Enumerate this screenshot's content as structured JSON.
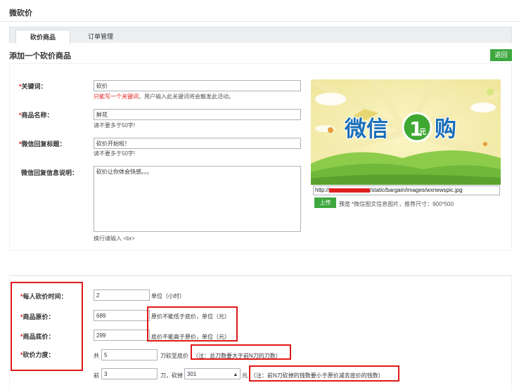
{
  "page_title": "微砍价",
  "tabs": [
    {
      "label": "砍价商品",
      "active": true
    },
    {
      "label": "订单管理",
      "active": false
    }
  ],
  "section_title": "添加一个砍价商品",
  "back_label": "返回",
  "fields": {
    "keyword": {
      "label": "关键词：",
      "value": "砍价",
      "hint_prefix": "只能写一个关键词",
      "hint_suffix": "，用户输入此关键词将会触发此活动。"
    },
    "product_name": {
      "label": "商品名称：",
      "value": "鲜花",
      "hint": "请不要多于50字!"
    },
    "reply_title": {
      "label": "微信回复标题：",
      "value": "砍价开始啦！",
      "hint": "请不要多于50字!"
    },
    "reply_desc": {
      "label": "微信回复信息说明：",
      "value": "砍价让你体会快感。。。",
      "hint": "换行请输入 <br>"
    }
  },
  "image": {
    "url_prefix": "http://",
    "url_suffix": "/static/bargain/images/wxnewspic.jpg",
    "upload_label": "上传",
    "preview_link": "预览",
    "preview_note": "*微信图文信息图片，推荐尺寸：900*500",
    "banner_text_left": "微信",
    "banner_num": "1",
    "banner_unit": "元",
    "banner_text_right": "购"
  },
  "bargain": {
    "time_label": "每人砍价时间：",
    "time_value": "2",
    "time_unit": "单位（小时）",
    "orig_label": "商品原价：",
    "orig_value": "689",
    "orig_note": "原价不能低于底价，单位（元）",
    "floor_label": "商品底价：",
    "floor_value": "299",
    "floor_note": "底价不能高于原价，单位（元）",
    "force_label": "砍价力度：",
    "total_prefix": "共",
    "total_value": "5",
    "total_suffix": "刀砍至底价",
    "total_note": "（注：总刀数要大于前N刀的刀数）",
    "front_prefix": "前",
    "front_value": "3",
    "front_mid": "刀，砍掉",
    "front_amount": "301",
    "front_unit": "元",
    "front_note": "（注：前N刀砍掉的钱数要小于原价减去底价的钱数）"
  },
  "colors": {
    "accent_green": "#3ea83e",
    "required_red": "#e02020",
    "annotation_red": "#e01818"
  }
}
